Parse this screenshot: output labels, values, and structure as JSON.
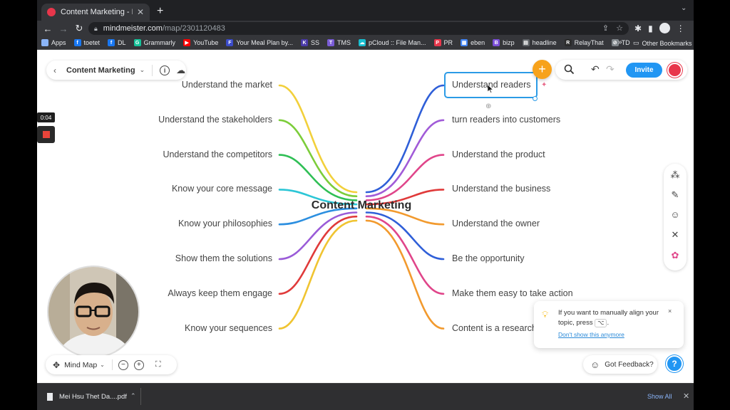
{
  "browser": {
    "tab_title": "Content Marketing - MindMeist",
    "tab_close": "✕",
    "new_tab": "+",
    "url_host": "mindmeister.com",
    "url_path": "/map/2301120483",
    "bookmarks": [
      {
        "label": "Apps",
        "icon_color": "#8ab4f8",
        "glyph": ""
      },
      {
        "label": "toetet",
        "icon_color": "#1877f2",
        "glyph": "f"
      },
      {
        "label": "DL",
        "icon_color": "#1877f2",
        "glyph": "f"
      },
      {
        "label": "Grammarly",
        "icon_color": "#15c39a",
        "glyph": "G"
      },
      {
        "label": "YouTube",
        "icon_color": "#ff0000",
        "glyph": "▶"
      },
      {
        "label": "Your Meal Plan by...",
        "icon_color": "#3b4cca",
        "glyph": "F"
      },
      {
        "label": "SS",
        "icon_color": "#4a3aa8",
        "glyph": "K"
      },
      {
        "label": "TMS",
        "icon_color": "#7a5cd6",
        "glyph": "T"
      },
      {
        "label": "pCloud :: File Man...",
        "icon_color": "#17bed0",
        "glyph": "☁"
      },
      {
        "label": "PR",
        "icon_color": "#e8364b",
        "glyph": "P"
      },
      {
        "label": "eben",
        "icon_color": "#4285f4",
        "glyph": "▦"
      },
      {
        "label": "bizp",
        "icon_color": "#7b4fd8",
        "glyph": "B"
      },
      {
        "label": "headline",
        "icon_color": "#5f6368",
        "glyph": "▤"
      },
      {
        "label": "RelayThat",
        "icon_color": "#2b2b2b",
        "glyph": "R"
      },
      {
        "label": "TD",
        "icon_color": "#80868b",
        "glyph": "⊘"
      }
    ],
    "bookmarks_more": "»",
    "other_bookmarks": "Other Bookmarks"
  },
  "app": {
    "doc_title": "Content Marketing",
    "invite_label": "Invite",
    "view_mode": "Mind Map",
    "feedback_label": "Got Feedback?",
    "help_label": "?",
    "add_label": "+"
  },
  "recording": {
    "timer": "0:04"
  },
  "mindmap": {
    "central": "Content Marketing",
    "left_branches": [
      {
        "label": "Understand the market",
        "color": "#f2d03b"
      },
      {
        "label": "Understand the stakeholders",
        "color": "#7ccd3a"
      },
      {
        "label": "Understand the competitors",
        "color": "#2fbf55"
      },
      {
        "label": "Know your core message",
        "color": "#2cc6d6"
      },
      {
        "label": "Know your philosophies",
        "color": "#2c8fe0"
      },
      {
        "label": "Show them the solutions",
        "color": "#9a5bd8"
      },
      {
        "label": "Always keep them engage",
        "color": "#e03a3a"
      },
      {
        "label": "Know your sequences",
        "color": "#f0c431"
      }
    ],
    "right_branches": [
      {
        "label": "Understand readers",
        "color": "#2f5fd8"
      },
      {
        "label": "turn readers into customers",
        "color": "#a15bd8"
      },
      {
        "label": "Understand the product",
        "color": "#e0458a"
      },
      {
        "label": "Understand the business",
        "color": "#e03a3a"
      },
      {
        "label": "Understand the owner",
        "color": "#f29a2e"
      },
      {
        "label": "Be the opportunity",
        "color": "#2f5fd8"
      },
      {
        "label": "Make them easy to take action",
        "color": "#e0458a"
      },
      {
        "label": "Content is a research",
        "color": "#f29a2e"
      }
    ]
  },
  "tip": {
    "text": "If you want to manually align your topic, press",
    "key": "⌥",
    "text_end": ".",
    "link": "Don't show this anymore",
    "close": "×"
  },
  "downloads": {
    "file_name": "Mei Hsu Thet Da....pdf",
    "show_all": "Show All",
    "close": "✕"
  },
  "colors": {
    "accent": "#2196f3",
    "brand": "#e8364b",
    "fab": "#f7a21b"
  }
}
